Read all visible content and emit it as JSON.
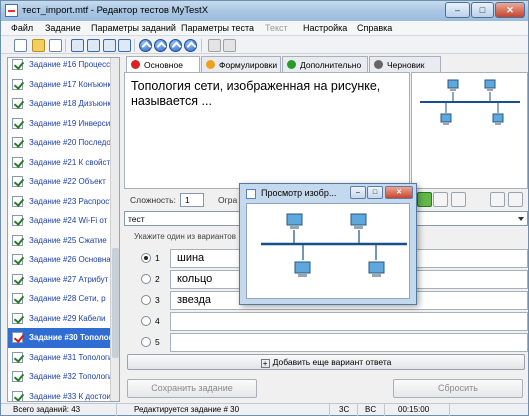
{
  "window": {
    "title": "тест_import.mtf - Редактор тестов MyTestX"
  },
  "menu": {
    "file": "Файл",
    "task": "Задание",
    "task_params": "Параметры заданий",
    "test_params": "Параметры теста",
    "text": "Текст",
    "settings": "Настройка",
    "help": "Справка"
  },
  "tasks": [
    "Задание #16 Процессор",
    "Задание #17 Конъюнкция",
    "Задание #18 Дизъюнкция",
    "Задание #19 Инверсия",
    "Задание #20 Последовательность",
    "Задание #21 К свойствам",
    "Задание #22 Объект",
    "Задание #23 Распространение",
    "Задание #24 Wi-Fi от",
    "Задание #25 Сжатие",
    "Задание #26 Основная",
    "Задание #27 Атрибут",
    "Задание #28 Сети, р",
    "Задание #29 Кабели",
    "Задание #30 Топология",
    "Задание #31 Топология",
    "Задание #32 Топология",
    "Задание #33 К достоинствам",
    "Задание #34 К достоинствам"
  ],
  "tabs": [
    {
      "label": "Основное",
      "color": "#e02020"
    },
    {
      "label": "Формулировки",
      "color": "#f0a020"
    },
    {
      "label": "Дополнительно",
      "color": "#2a9a2a"
    },
    {
      "label": "Черновик",
      "color": "#666666"
    }
  ],
  "question": {
    "text": "Топология сети, изображенная на рисунке, называется ..."
  },
  "difficulty": {
    "label": "Сложность:",
    "value": "1",
    "limit_label": "Огра"
  },
  "task_type": {
    "value": "тест"
  },
  "answers": {
    "hint": "Укажите один из вариантов",
    "items": [
      {
        "num": "1",
        "text": "шина",
        "selected": true
      },
      {
        "num": "2",
        "text": "кольцо",
        "selected": false
      },
      {
        "num": "3",
        "text": "звезда",
        "selected": false
      },
      {
        "num": "4",
        "text": "",
        "selected": false
      },
      {
        "num": "5",
        "text": "",
        "selected": false
      }
    ],
    "add_label": "Добавить еще вариант ответа"
  },
  "buttons": {
    "save": "Сохранить задание",
    "reset": "Сбросить"
  },
  "status": {
    "total": "Всего заданий: 43",
    "editing": "Редактируется задание # 30",
    "caps": "3C",
    "bc": "BC",
    "time": "00:15:00"
  },
  "popup": {
    "title": "Просмотр изобр..."
  },
  "icons": {
    "app": "document-icon",
    "monitor": "computer-icon"
  }
}
